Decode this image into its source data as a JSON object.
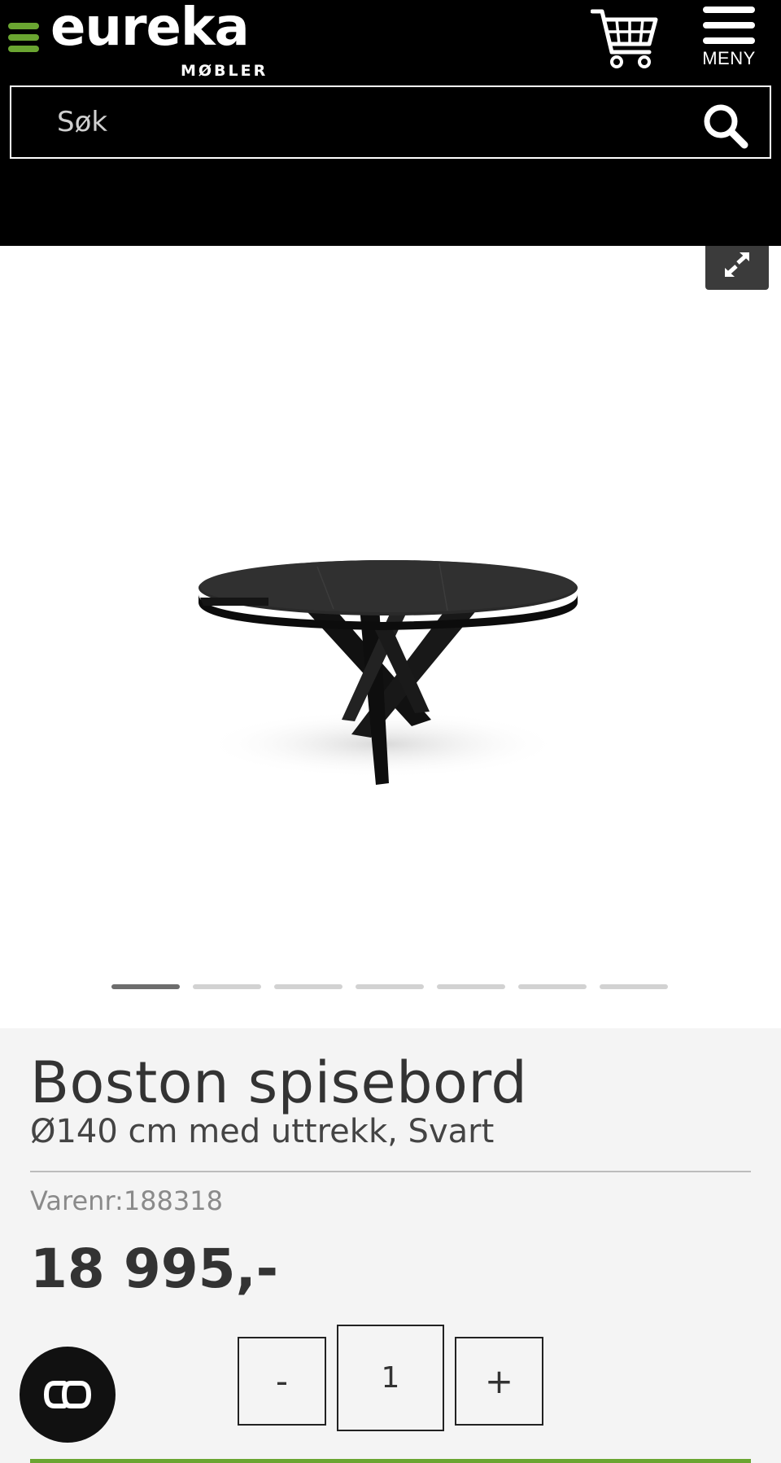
{
  "header": {
    "logo_text": "eureka",
    "logo_subtext": "MØBLER",
    "cart_icon": "shopping-cart-icon",
    "menu_label": "MENY",
    "menu_icon": "hamburger-menu-icon",
    "brand_color": "#6aa531",
    "background_color": "#000000"
  },
  "search": {
    "placeholder": "Søk",
    "value": "",
    "icon": "search-icon"
  },
  "gallery": {
    "expand_icon": "expand-icon",
    "image_description_icon": "round-dining-table-image",
    "slide_count": 7,
    "active_slide": 1
  },
  "product": {
    "title": "Boston spisebord",
    "subtitle": "Ø140 cm med uttrekk, Svart",
    "sku_label": "Varenr:",
    "sku_value": "188318",
    "price": "18 995,-"
  },
  "quantity": {
    "minus_label": "-",
    "value": "1",
    "plus_label": "+"
  },
  "chat": {
    "icon": "chat-bubble-icon"
  }
}
